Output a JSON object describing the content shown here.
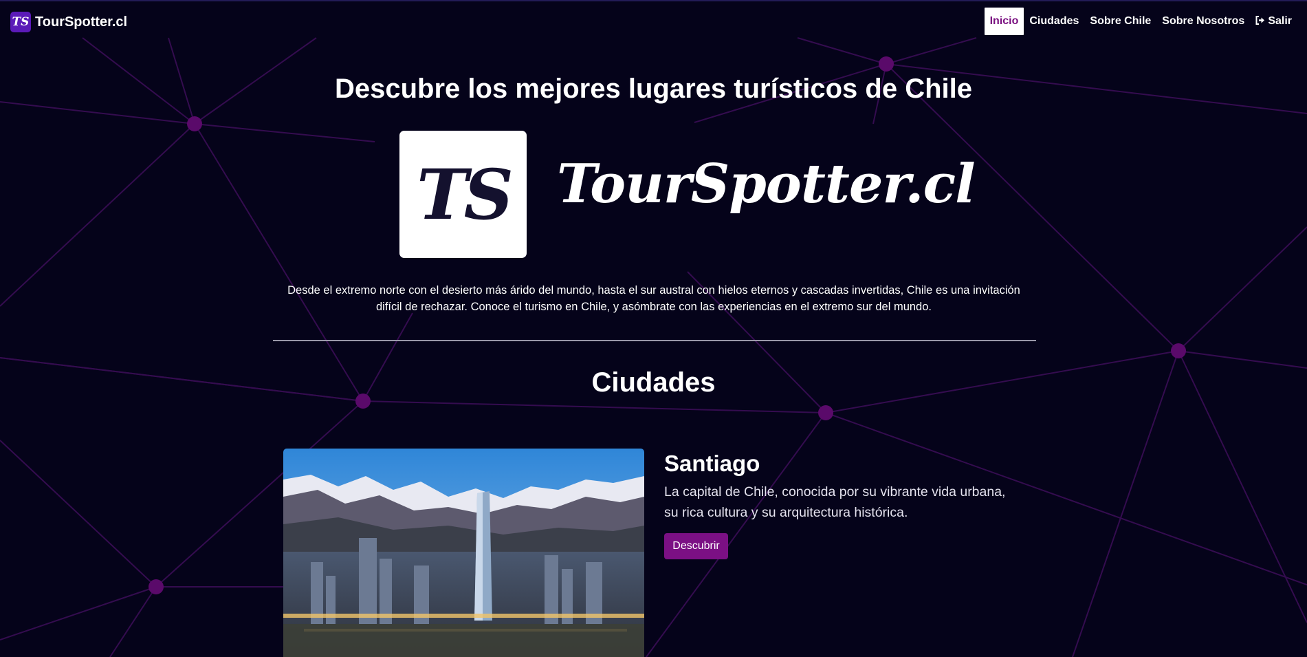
{
  "navbar": {
    "brand_logo": "TS",
    "brand_name": "TourSpotter.cl",
    "links": [
      {
        "label": "Inicio",
        "active": true
      },
      {
        "label": "Ciudades",
        "active": false
      },
      {
        "label": "Sobre Chile",
        "active": false
      },
      {
        "label": "Sobre Nosotros",
        "active": false
      }
    ],
    "logout": {
      "label": "Salir",
      "icon": "sign-out-icon"
    }
  },
  "hero": {
    "title": "Descubre los mejores lugares turísticos de Chile",
    "logo_text": "TS",
    "brand_text": "TourSpotter.cl",
    "description": "Desde el extremo norte con el desierto más árido del mundo, hasta el sur austral con hielos eternos y cascadas invertidas, Chile es una invitación difícil de rechazar. Conoce el turismo en Chile, y asómbrate con las experiencias en el extremo sur del mundo."
  },
  "cities_section": {
    "title": "Ciudades",
    "cities": [
      {
        "name": "Santiago",
        "description": "La capital de Chile, conocida por su vibrante vida urbana, su rica cultura y su arquitectura histórica.",
        "button_label": "Descubrir"
      }
    ]
  },
  "colors": {
    "background": "#05031a",
    "accent": "#7b1084",
    "network_lines": "#3a0d52",
    "network_nodes": "#5a0a6a"
  }
}
